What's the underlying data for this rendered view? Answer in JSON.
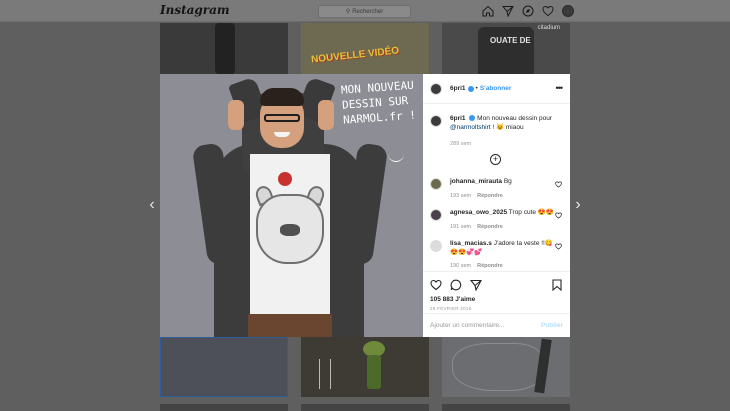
{
  "nav": {
    "logo": "Instagram",
    "search_placeholder": "Rechercher",
    "icons": [
      "home-icon",
      "direct-icon",
      "explore-icon",
      "heart-icon",
      "profile-avatar"
    ]
  },
  "background_tiles": {
    "tile2_text": "NOUVELLE VIDÉO",
    "tile3_brand": "citadium",
    "tile3_text": "OUATE DE"
  },
  "photo": {
    "doodle_text": "MON NOUVEAU DESSIN SUR NARMOL.fr !"
  },
  "post": {
    "username": "6pri1",
    "follow_label": "S'abonner",
    "dot": "•",
    "caption_user": "6pri1",
    "caption_text": "Mon nouveau dessin pour",
    "caption_mention": "@narmoltshirt",
    "caption_end": "! 😺 miaou",
    "caption_time": "289 sem",
    "comments": [
      {
        "user": "johanna_mirauta",
        "text": "Bg",
        "time": "193 sem",
        "reply": "Répondre"
      },
      {
        "user": "agnesa_owo_2025",
        "text": "Trop cute 😍😍",
        "time": "191 sem",
        "reply": "Répondre"
      },
      {
        "user": "lisa_macias.s",
        "text": "J'adore ta veste !!😋😍😍💞💕",
        "time": "190 sem",
        "reply": "Répondre"
      }
    ],
    "likes": "105 883 J'aime",
    "date": "26 FÉVRIER 2016",
    "comment_placeholder": "Ajouter un commentaire...",
    "publish_label": "Publier"
  },
  "colors": {
    "accent": "#3897f0",
    "publish_disabled": "#b2dffc",
    "overlay": "#5f5f5f"
  }
}
